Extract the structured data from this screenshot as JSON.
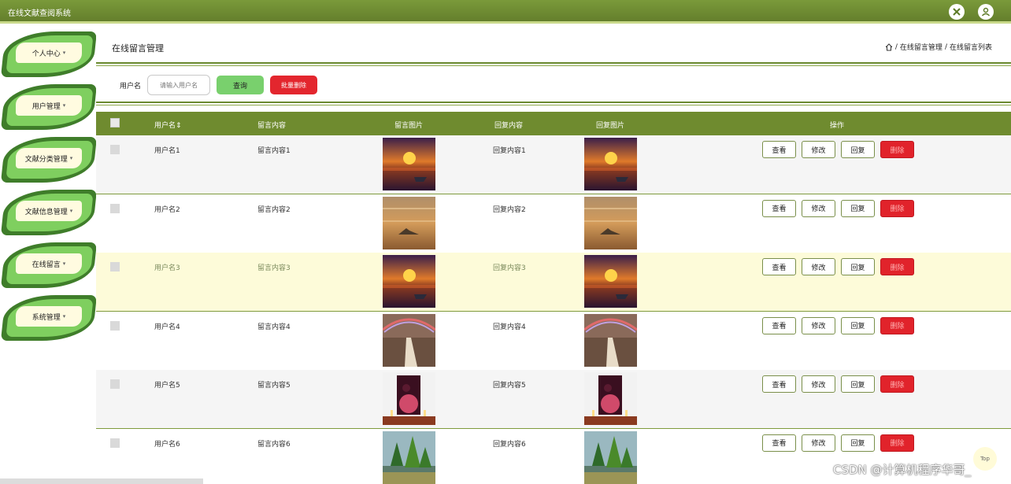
{
  "app": {
    "title": "在线文献查阅系统"
  },
  "topbar": {
    "icons": [
      "fullscreen-icon",
      "user-icon"
    ]
  },
  "sidebar": {
    "items": [
      {
        "label": "个人中心",
        "icon": "caret-down-icon"
      },
      {
        "label": "用户管理",
        "icon": "caret-down-icon"
      },
      {
        "label": "文献分类管理",
        "icon": "caret-down-icon"
      },
      {
        "label": "文献信息管理",
        "icon": "caret-down-icon"
      },
      {
        "label": "在线留言",
        "icon": "caret-down-icon"
      },
      {
        "label": "系统管理",
        "icon": "caret-down-icon"
      }
    ]
  },
  "page": {
    "title": "在线留言管理",
    "breadcrumb": [
      "在线留言管理",
      "在线留言列表"
    ],
    "breadcrumb_sep": "/"
  },
  "search": {
    "label": "用户名",
    "placeholder": "请输入用户名",
    "query_button": "查询",
    "batch_delete_button": "批量删除"
  },
  "table": {
    "headers": {
      "username": "用户名",
      "message": "留言内容",
      "message_image": "留言图片",
      "reply": "回复内容",
      "reply_image": "回复图片",
      "actions": "操作"
    },
    "sort_icon": "sort-icon",
    "action_labels": {
      "view": "查看",
      "edit": "修改",
      "reply": "回复",
      "delete": "删除"
    },
    "rows": [
      {
        "username": "用户名1",
        "message": "留言内容1",
        "reply": "回复内容1",
        "image": "sunset-lake",
        "highlighted": false
      },
      {
        "username": "用户名2",
        "message": "留言内容2",
        "reply": "回复内容2",
        "image": "misty-island",
        "highlighted": false
      },
      {
        "username": "用户名3",
        "message": "留言内容3",
        "reply": "回复内容3",
        "image": "sunset-lake",
        "highlighted": true
      },
      {
        "username": "用户名4",
        "message": "留言内容4",
        "reply": "回复内容4",
        "image": "rainbow-path",
        "highlighted": false
      },
      {
        "username": "用户名5",
        "message": "留言内容5",
        "reply": "回复内容5",
        "image": "pink-painting",
        "highlighted": false
      },
      {
        "username": "用户名6",
        "message": "留言内容6",
        "reply": "回复内容6",
        "image": "green-trees",
        "highlighted": false
      }
    ]
  },
  "colors": {
    "accent": "#6f8b2f",
    "danger": "#e1232b",
    "query": "#79d06d",
    "highlight_row": "#fdfbd9"
  },
  "back_to_top": "Top",
  "watermark": "CSDN @计算机程序华哥_"
}
